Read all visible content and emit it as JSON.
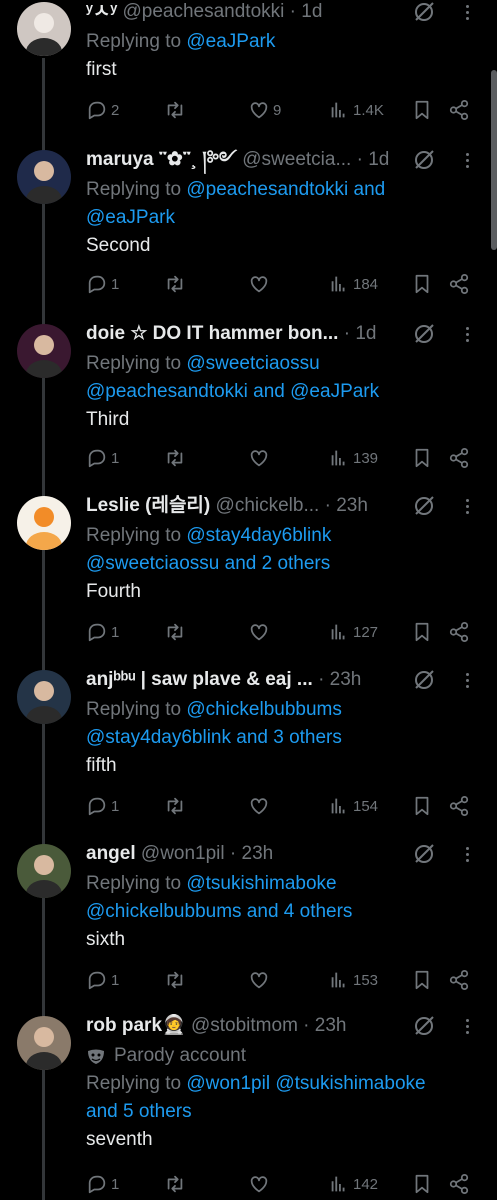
{
  "tweets": [
    {
      "name": "ʸㅅʸ",
      "handle": "@peachesandtokki",
      "time": "1d",
      "reply_prefix": "Replying to ",
      "reply_line1": "@eaJPark",
      "reply_line2": "",
      "text": "first",
      "replies": "2",
      "retweets": "",
      "likes": "9",
      "views": "1.4K",
      "avatar_color": "#cfc7c2"
    },
    {
      "name": "maruya ་༌✿་༌¸ །༻",
      "handle": "@sweetcia...",
      "time": "1d",
      "reply_prefix": "Replying to ",
      "reply_line1": "@peachesandtokki and",
      "reply_line2": "@eaJPark",
      "text": "Second",
      "replies": "1",
      "retweets": "",
      "likes": "",
      "views": "184",
      "avatar_color": "#1f2a4a"
    },
    {
      "name": "doie ☆ DO IT hammer bon...",
      "handle": "",
      "time": "1d",
      "reply_prefix": "Replying to ",
      "reply_line1": "@sweetciaossu",
      "reply_line2": "@peachesandtokki and @eaJPark",
      "text": "Third",
      "replies": "1",
      "retweets": "",
      "likes": "",
      "views": "139",
      "avatar_color": "#3a1830"
    },
    {
      "name": "Leslie (레슬리)",
      "handle": "@chickelb...",
      "time": "23h",
      "reply_prefix": "Replying to ",
      "reply_line1": "@stay4day6blink",
      "reply_line2": "@sweetciaossu and 2 others",
      "text": "Fourth",
      "replies": "1",
      "retweets": "",
      "likes": "",
      "views": "127",
      "avatar_color": "#f6f1e8"
    },
    {
      "name": "anjᵇᵇᵘ | saw plave & eaj ...",
      "handle": "",
      "time": "23h",
      "reply_prefix": "Replying to ",
      "reply_line1": "@chickelbubbums",
      "reply_line2": "@stay4day6blink and 3 others",
      "text": "fifth",
      "replies": "1",
      "retweets": "",
      "likes": "",
      "views": "154",
      "avatar_color": "#243447"
    },
    {
      "name": "angel",
      "handle": "@won1pil",
      "time": "23h",
      "reply_prefix": "Replying to ",
      "reply_line1": "@tsukishimaboke",
      "reply_line2": "@chickelbubbums and 4 others",
      "text": "sixth",
      "replies": "1",
      "retweets": "",
      "likes": "",
      "views": "153",
      "avatar_color": "#4a5a3a"
    },
    {
      "name": "rob park🧑‍🚀",
      "handle": "@stobitmom",
      "time": "23h",
      "parody_label": "Parody account",
      "reply_prefix": "Replying to ",
      "reply_line1": "@won1pil @tsukishimaboke",
      "reply_line2": "and 5 others",
      "text": "seventh",
      "replies": "1",
      "retweets": "",
      "likes": "",
      "views": "142",
      "avatar_color": "#8a7a6a"
    }
  ],
  "colors": {
    "background": "#000000",
    "text": "#e7e9ea",
    "muted": "#71767b",
    "link": "#1d9bf0",
    "thread_line": "#333639"
  },
  "icons": [
    "reply-icon",
    "retweet-icon",
    "like-icon",
    "views-icon",
    "bookmark-icon",
    "share-icon",
    "grok-icon",
    "more-icon",
    "parody-mask-icon"
  ]
}
